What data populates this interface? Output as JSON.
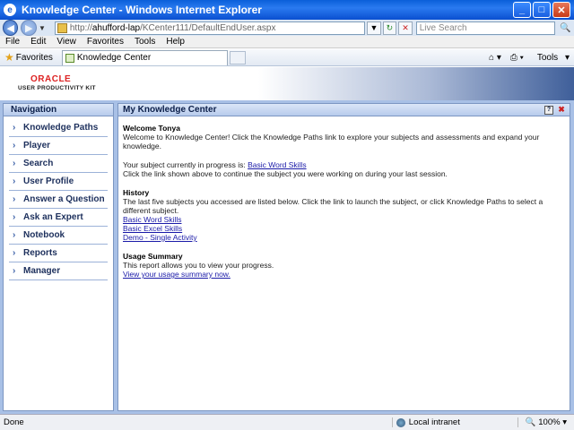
{
  "window": {
    "title": "Knowledge Center - Windows Internet Explorer"
  },
  "address": {
    "url_prefix": "http://",
    "url_host": "ahufford-lap",
    "url_path": "/KCenter111/DefaultEndUser.aspx",
    "search_placeholder": "Live Search"
  },
  "menu": [
    "File",
    "Edit",
    "View",
    "Favorites",
    "Tools",
    "Help"
  ],
  "favorites": {
    "label": "Favorites",
    "tab_label": "Knowledge Center",
    "page_label": "Page",
    "tools_label": "Tools"
  },
  "brand": {
    "logo": "ORACLE",
    "sub": "USER PRODUCTIVITY KIT"
  },
  "navigation": {
    "title": "Navigation",
    "items": [
      "Knowledge Paths",
      "Player",
      "Search",
      "User Profile",
      "Answer a Question",
      "Ask an Expert",
      "Notebook",
      "Reports",
      "Manager"
    ]
  },
  "content": {
    "title": "My Knowledge Center",
    "welcome_heading": "Welcome Tonya",
    "welcome_text": "Welcome to Knowledge Center! Click the Knowledge Paths link to explore your subjects and assessments and expand your knowledge.",
    "progress_text": "Your subject currently in progress is:",
    "progress_link": "Basic Word Skills",
    "progress_hint": "Click the link shown above to continue the subject you were working on during your last session.",
    "history_heading": "History",
    "history_text": "The last five subjects you accessed are listed below. Click the link to launch the subject, or click Knowledge Paths to select a different subject.",
    "history_links": [
      "Basic Word Skills",
      "Basic Excel Skills",
      "Demo - Single Activity"
    ],
    "usage_heading": "Usage Summary",
    "usage_text": "This report allows you to view your progress.",
    "usage_link": "View your usage summary now."
  },
  "status": {
    "left": "Done",
    "zone": "Local intranet",
    "zoom": "100%"
  }
}
